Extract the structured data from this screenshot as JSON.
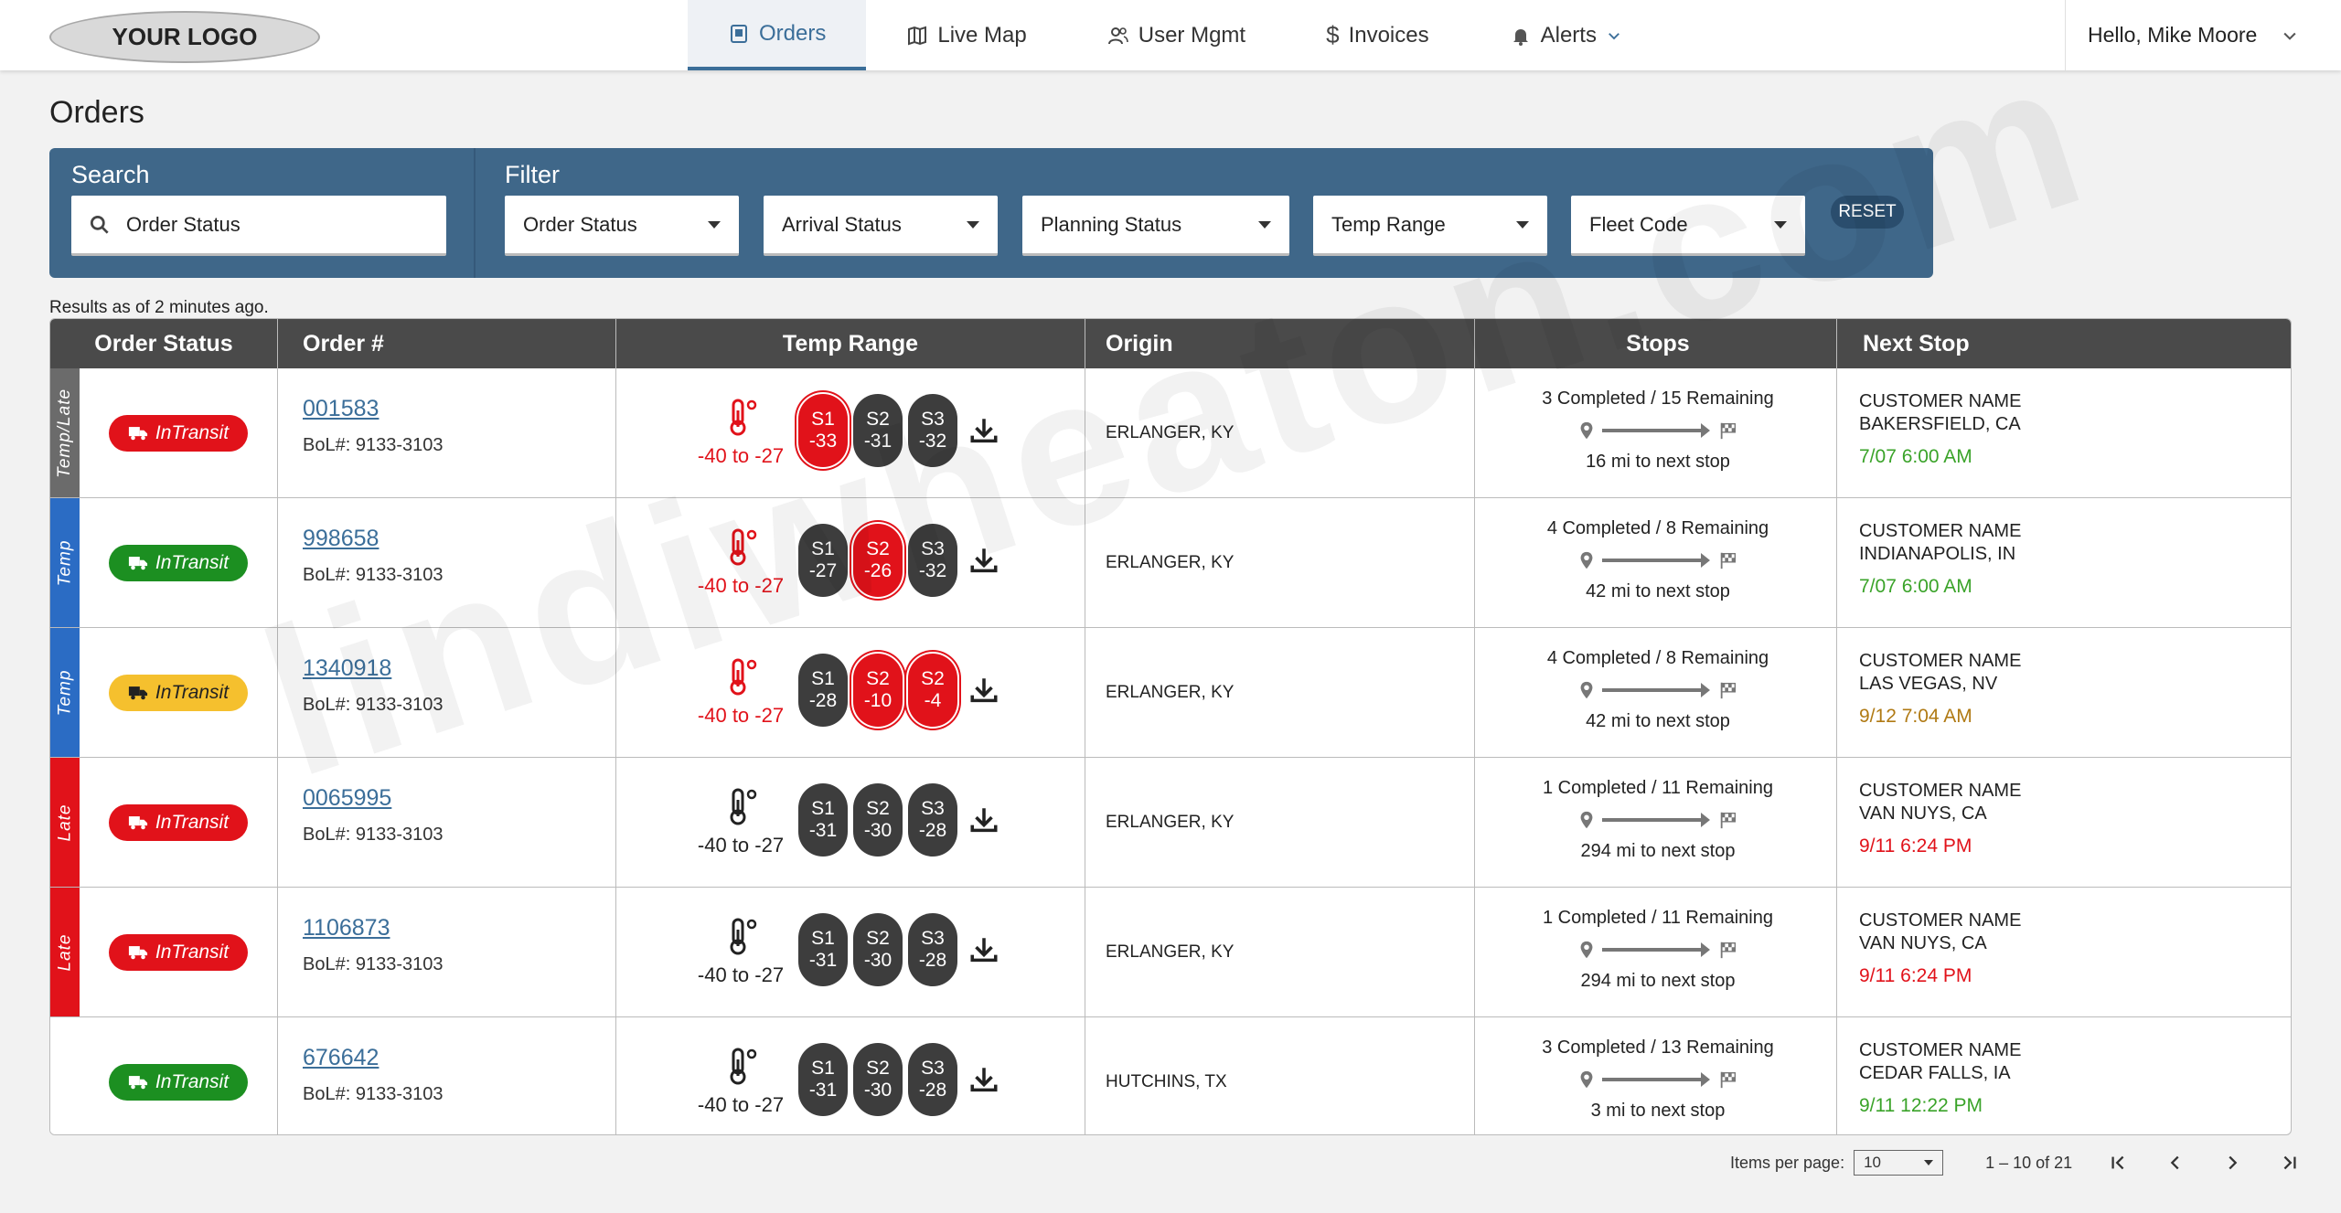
{
  "header": {
    "logo": "YOUR LOGO",
    "nav": [
      {
        "label": "Orders",
        "icon": "orders-icon",
        "active": true
      },
      {
        "label": "Live Map",
        "icon": "map-icon"
      },
      {
        "label": "User Mgmt",
        "icon": "users-icon"
      },
      {
        "label": "Invoices",
        "icon": "dollar-icon"
      },
      {
        "label": "Alerts",
        "icon": "bell-icon"
      }
    ],
    "greeting": "Hello, Mike Moore"
  },
  "page_title": "Orders",
  "filters": {
    "search_label": "Search",
    "search_value": "Order Status",
    "filter_label": "Filter",
    "dropdowns": [
      "Order Status",
      "Arrival Status",
      "Planning Status",
      "Temp Range",
      "Fleet Code"
    ],
    "reset": "RESET"
  },
  "results_note": "Results as of 2 minutes ago.",
  "table": {
    "headers": [
      "Order Status",
      "Order #",
      "Temp Range",
      "Origin",
      "Stops",
      "Next Stop"
    ],
    "rows": [
      {
        "flag": "Temp/Late",
        "flag_color": "#6b6b6b",
        "status": "InTransit",
        "status_color": "red",
        "order": "001583",
        "bol": "BoL#: 9133-3103",
        "temp_alert": true,
        "temp_range": "-40 to -27",
        "sensors": [
          [
            "S1",
            "-33",
            true
          ],
          [
            "S2",
            "-31",
            false
          ],
          [
            "S3",
            "-32",
            false
          ]
        ],
        "origin": "ERLANGER, KY",
        "stops_summary": "3 Completed / 15 Remaining",
        "distance": "16 mi to next stop",
        "customer": "CUSTOMER NAME",
        "city": "BAKERSFIELD, CA",
        "eta": "7/07 6:00 AM",
        "eta_color": "#3aa329"
      },
      {
        "flag": "Temp",
        "flag_color": "#2b6cc4",
        "status": "InTransit",
        "status_color": "green",
        "order": "998658",
        "bol": "BoL#: 9133-3103",
        "temp_alert": true,
        "temp_range": "-40 to -27",
        "sensors": [
          [
            "S1",
            "-27",
            false
          ],
          [
            "S2",
            "-26",
            true
          ],
          [
            "S3",
            "-32",
            false
          ]
        ],
        "origin": "ERLANGER, KY",
        "stops_summary": "4 Completed / 8 Remaining",
        "distance": "42 mi to next stop",
        "customer": "CUSTOMER NAME",
        "city": "INDIANAPOLIS, IN",
        "eta": "7/07 6:00 AM",
        "eta_color": "#3aa329"
      },
      {
        "flag": "Temp",
        "flag_color": "#2b6cc4",
        "status": "InTransit",
        "status_color": "yellow",
        "order": "1340918",
        "bol": "BoL#: 9133-3103",
        "temp_alert": true,
        "temp_range": "-40 to -27",
        "sensors": [
          [
            "S1",
            "-28",
            false
          ],
          [
            "S2",
            "-10",
            true
          ],
          [
            "S2",
            "-4",
            true
          ]
        ],
        "origin": "ERLANGER, KY",
        "stops_summary": "4 Completed / 8 Remaining",
        "distance": "42 mi to next stop",
        "customer": "CUSTOMER NAME",
        "city": "LAS VEGAS, NV",
        "eta": "9/12 7:04 AM",
        "eta_color": "#b07a14"
      },
      {
        "flag": "Late",
        "flag_color": "#e1121a",
        "status": "InTransit",
        "status_color": "red",
        "order": "0065995",
        "bol": "BoL#: 9133-3103",
        "temp_alert": false,
        "temp_range": "-40 to -27",
        "sensors": [
          [
            "S1",
            "-31",
            false
          ],
          [
            "S2",
            "-30",
            false
          ],
          [
            "S3",
            "-28",
            false
          ]
        ],
        "origin": "ERLANGER, KY",
        "stops_summary": "1 Completed / 11 Remaining",
        "distance": "294 mi to next stop",
        "customer": "CUSTOMER NAME",
        "city": "VAN NUYS, CA",
        "eta": "9/11 6:24 PM",
        "eta_color": "#e1121a"
      },
      {
        "flag": "Late",
        "flag_color": "#e1121a",
        "status": "InTransit",
        "status_color": "red",
        "order": "1106873",
        "bol": "BoL#: 9133-3103",
        "temp_alert": false,
        "temp_range": "-40 to -27",
        "sensors": [
          [
            "S1",
            "-31",
            false
          ],
          [
            "S2",
            "-30",
            false
          ],
          [
            "S3",
            "-28",
            false
          ]
        ],
        "origin": "ERLANGER, KY",
        "stops_summary": "1 Completed / 11 Remaining",
        "distance": "294 mi to next stop",
        "customer": "CUSTOMER NAME",
        "city": "VAN NUYS, CA",
        "eta": "9/11 6:24 PM",
        "eta_color": "#e1121a"
      },
      {
        "flag": "",
        "flag_color": "#ffffff",
        "status": "InTransit",
        "status_color": "green",
        "order": "676642",
        "bol": "BoL#: 9133-3103",
        "temp_alert": false,
        "temp_range": "-40 to -27",
        "sensors": [
          [
            "S1",
            "-31",
            false
          ],
          [
            "S2",
            "-30",
            false
          ],
          [
            "S3",
            "-28",
            false
          ]
        ],
        "origin": "HUTCHINS, TX",
        "stops_summary": "3 Completed / 13 Remaining",
        "distance": "3 mi to next stop",
        "customer": "CUSTOMER NAME",
        "city": "CEDAR FALLS, IA",
        "eta": "9/11 12:22 PM",
        "eta_color": "#3aa329"
      }
    ]
  },
  "pagination": {
    "per_page_label": "Items per page:",
    "per_page_value": "10",
    "range": "1 – 10 of 21"
  },
  "watermark": "lindiwheaton.com"
}
